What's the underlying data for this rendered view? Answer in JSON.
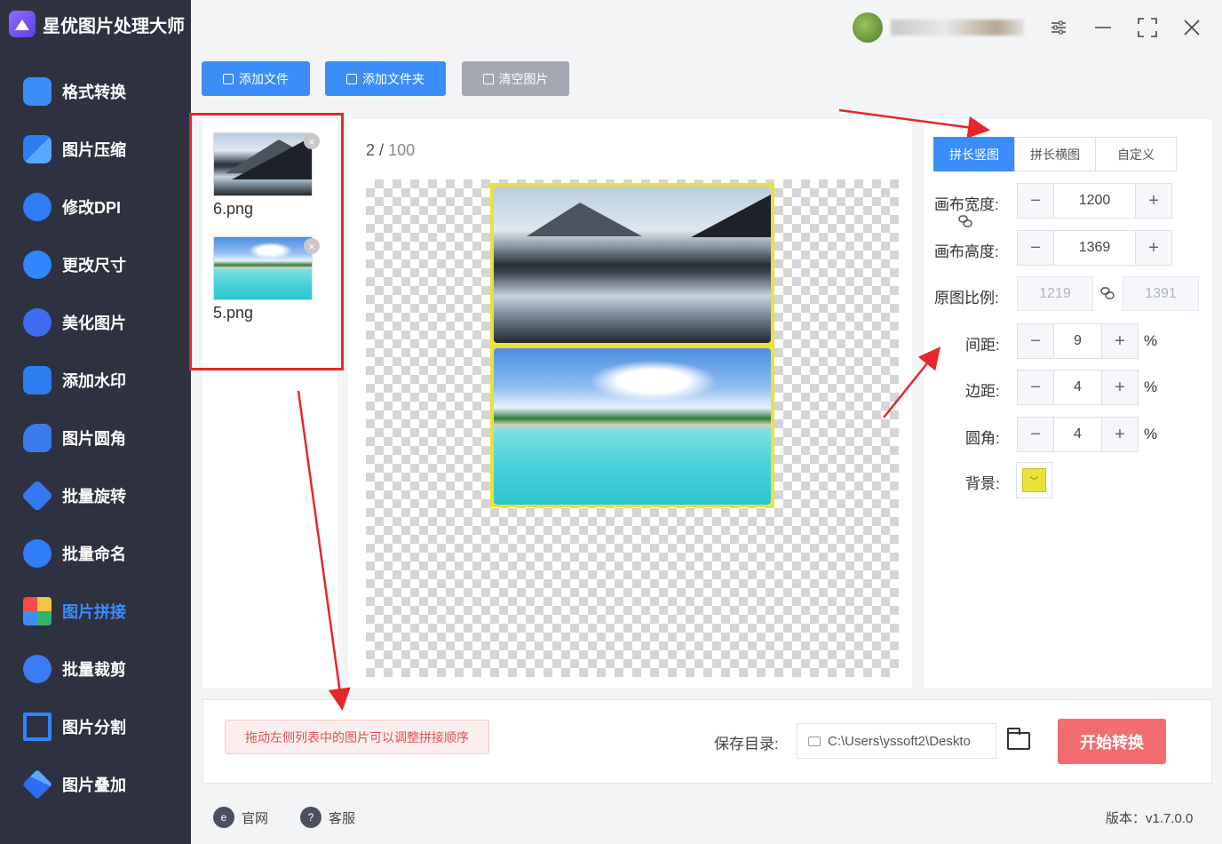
{
  "app": {
    "title": "星优图片处理大师"
  },
  "sidebar": {
    "items": [
      {
        "label": "格式转换",
        "icon": "format-convert-icon"
      },
      {
        "label": "图片压缩",
        "icon": "compress-icon"
      },
      {
        "label": "修改DPI",
        "icon": "dpi-icon"
      },
      {
        "label": "更改尺寸",
        "icon": "resize-icon"
      },
      {
        "label": "美化图片",
        "icon": "beautify-icon"
      },
      {
        "label": "添加水印",
        "icon": "watermark-icon"
      },
      {
        "label": "图片圆角",
        "icon": "round-corner-icon"
      },
      {
        "label": "批量旋转",
        "icon": "rotate-icon"
      },
      {
        "label": "批量命名",
        "icon": "rename-icon"
      },
      {
        "label": "图片拼接",
        "icon": "stitch-icon",
        "active": true
      },
      {
        "label": "批量裁剪",
        "icon": "crop-icon"
      },
      {
        "label": "图片分割",
        "icon": "split-icon"
      },
      {
        "label": "图片叠加",
        "icon": "overlay-icon"
      }
    ]
  },
  "toolbar": {
    "add_file": "添加文件",
    "add_folder": "添加文件夹",
    "clear_images": "清空图片"
  },
  "files": [
    {
      "name": "6.png",
      "kind": "mountain"
    },
    {
      "name": "5.png",
      "kind": "beach"
    }
  ],
  "preview": {
    "current": "2",
    "separator": "/",
    "total": "100"
  },
  "settings": {
    "tabs": [
      "拼长竖图",
      "拼长横图",
      "自定义"
    ],
    "active_tab": 0,
    "canvas_width_label": "画布宽度:",
    "canvas_width": "1200",
    "canvas_height_label": "画布高度:",
    "canvas_height": "1369",
    "ratio_label": "原图比例:",
    "ratio_w": "1219",
    "ratio_h": "1391",
    "spacing_label": "间距:",
    "spacing": "9",
    "margin_label": "边距:",
    "margin": "4",
    "radius_label": "圆角:",
    "radius": "4",
    "percent": "%",
    "background_label": "背景:",
    "background_color": "#e8e23a"
  },
  "bottom": {
    "hint": "拖动左侧列表中的图片可以调整拼接顺序",
    "save_label": "保存目录:",
    "save_path": "C:\\Users\\yssoft2\\Deskto",
    "start": "开始转换"
  },
  "footer": {
    "website": "官网",
    "support": "客服",
    "version": "版本：v1.7.0.0"
  },
  "colors": {
    "sidebar_bg": "#2d3140",
    "accent": "#3b8efa",
    "start_button": "#f26d6d",
    "annotation_red": "#e8262a"
  }
}
